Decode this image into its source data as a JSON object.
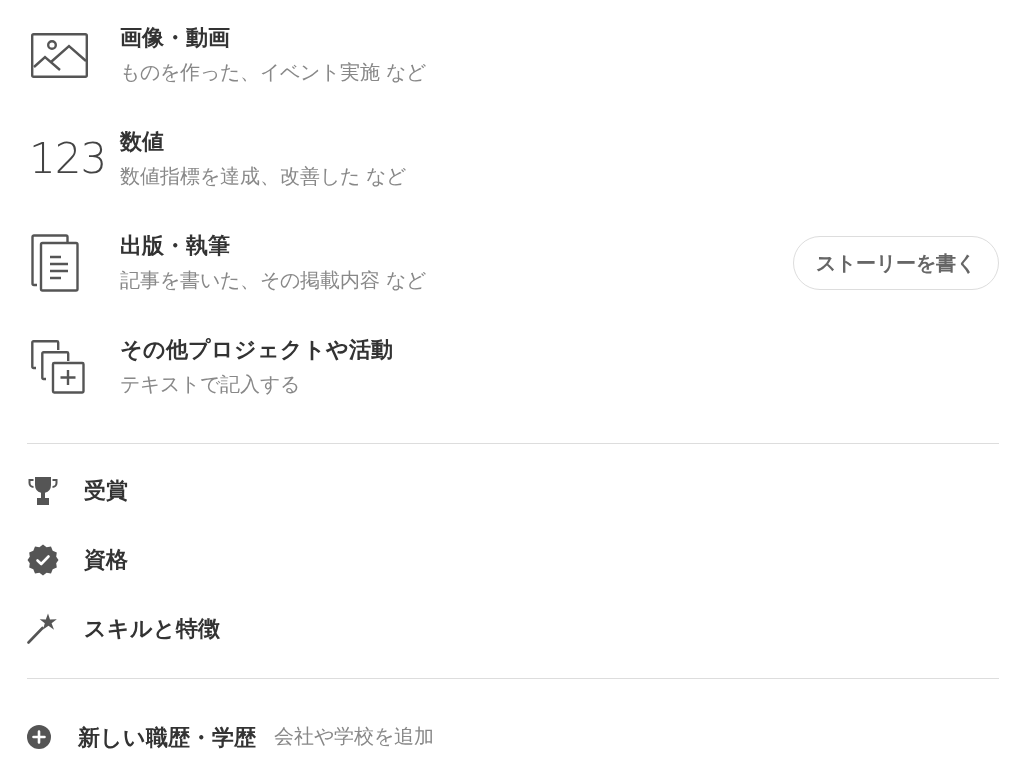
{
  "story_types": [
    {
      "kind": "image",
      "title": "画像・動画",
      "description": "ものを作った、イベント実施 など"
    },
    {
      "kind": "number",
      "icon_text": "123",
      "title": "数値",
      "description": "数値指標を達成、改善した など"
    },
    {
      "kind": "document",
      "title": "出版・執筆",
      "description": "記事を書いた、その掲載内容 など"
    },
    {
      "kind": "other",
      "title": "その他プロジェクトや活動",
      "description": "テキストで記入する"
    }
  ],
  "write_story_button": "ストーリーを書く",
  "sections": [
    {
      "kind": "award",
      "label": "受賞"
    },
    {
      "kind": "certification",
      "label": "資格"
    },
    {
      "kind": "skill",
      "label": "スキルと特徴"
    }
  ],
  "add_career": {
    "title": "新しい職歴・学歴",
    "hint": "会社や学校を追加"
  }
}
